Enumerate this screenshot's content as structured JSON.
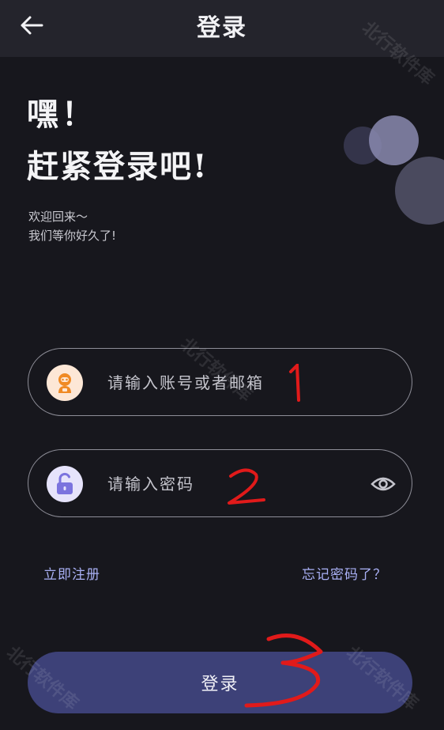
{
  "topbar": {
    "title": "登录",
    "back_icon": "arrow-left-icon"
  },
  "hero": {
    "greeting": "嘿！",
    "title": "赶紧登录吧!",
    "welcome_line1": "欢迎回来～",
    "welcome_line2": "我们等你好久了!"
  },
  "form": {
    "account": {
      "placeholder": "请输入账号或者邮箱",
      "value": "",
      "icon": "robot-avatar-icon",
      "icon_color": "#f08a24"
    },
    "password": {
      "placeholder": "请输入密码",
      "value": "",
      "icon": "unlock-icon",
      "icon_color": "#7b73de",
      "toggle_icon": "eye-icon"
    }
  },
  "links": {
    "register": "立即注册",
    "forgot": "忘记密码了？"
  },
  "login_button": {
    "label": "登录"
  },
  "annotations": [
    "1",
    "2",
    "3"
  ],
  "watermark": "北行软件库",
  "colors": {
    "background": "#17171d",
    "topbar": "#24242c",
    "link": "#a9b0f5",
    "button": "#3d4178",
    "annotation": "#e11a1a"
  }
}
